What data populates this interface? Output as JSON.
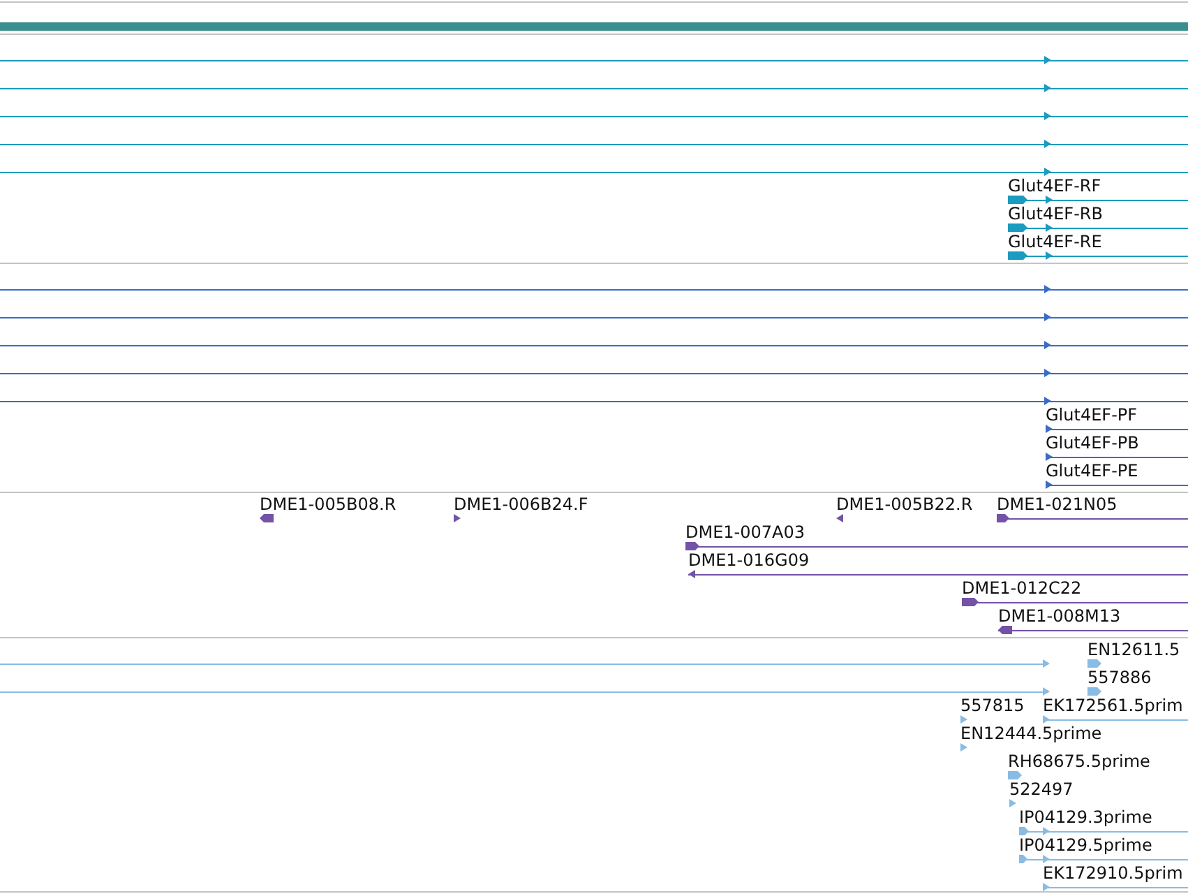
{
  "tracks": [
    {
      "kind": "summary",
      "color": "#3a8e8e"
    },
    {
      "kind": "features",
      "color": "#1a9bbf",
      "features": [
        {
          "reverse": false
        },
        {
          "reverse": false
        },
        {
          "reverse": false
        },
        {
          "reverse": false
        },
        {
          "reverse": false
        },
        {
          "label": "Glut4EF-RF",
          "reverse": false
        },
        {
          "label": "Glut4EF-RB",
          "reverse": false
        },
        {
          "label": "Glut4EF-RE",
          "reverse": false
        }
      ]
    },
    {
      "kind": "features",
      "color": "#3a6cc8",
      "features": [
        {
          "reverse": false
        },
        {
          "reverse": false
        },
        {
          "reverse": false
        },
        {
          "reverse": false
        },
        {
          "reverse": false
        },
        {
          "label": "Glut4EF-PF",
          "reverse": false
        },
        {
          "label": "Glut4EF-PB",
          "reverse": false
        },
        {
          "label": "Glut4EF-PE",
          "reverse": false
        }
      ]
    },
    {
      "kind": "features",
      "color": "#7452a8",
      "features": [
        {
          "label": "DME1-005B08.R",
          "reverse": true
        },
        {
          "label": "DME1-006B24.F",
          "reverse": false
        },
        {
          "label": "DME1-005B22.R",
          "reverse": true
        },
        {
          "label": "DME1-021N05",
          "reverse": false
        },
        {
          "label": "DME1-007A03",
          "reverse": false
        },
        {
          "label": "DME1-016G09",
          "reverse": true
        },
        {
          "label": "DME1-012C22",
          "reverse": false
        },
        {
          "label": "DME1-008M13",
          "reverse": true
        }
      ]
    },
    {
      "kind": "features",
      "color": "#88bce4",
      "features": [
        {
          "reverse": false
        },
        {
          "reverse": false
        },
        {
          "label": "EN12611.5",
          "reverse": false
        },
        {
          "label": "557886",
          "reverse": false
        },
        {
          "label": "557815",
          "reverse": false
        },
        {
          "label": "EK172561.5prim",
          "reverse": false
        },
        {
          "label": "EN12444.5prime",
          "reverse": false
        },
        {
          "label": "RH68675.5prime",
          "reverse": false
        },
        {
          "label": "522497",
          "reverse": false
        },
        {
          "label": "IP04129.3prime",
          "reverse": false
        },
        {
          "label": "IP04129.5prime",
          "reverse": false
        },
        {
          "label": "EK172910.5prim",
          "reverse": false
        }
      ]
    }
  ]
}
